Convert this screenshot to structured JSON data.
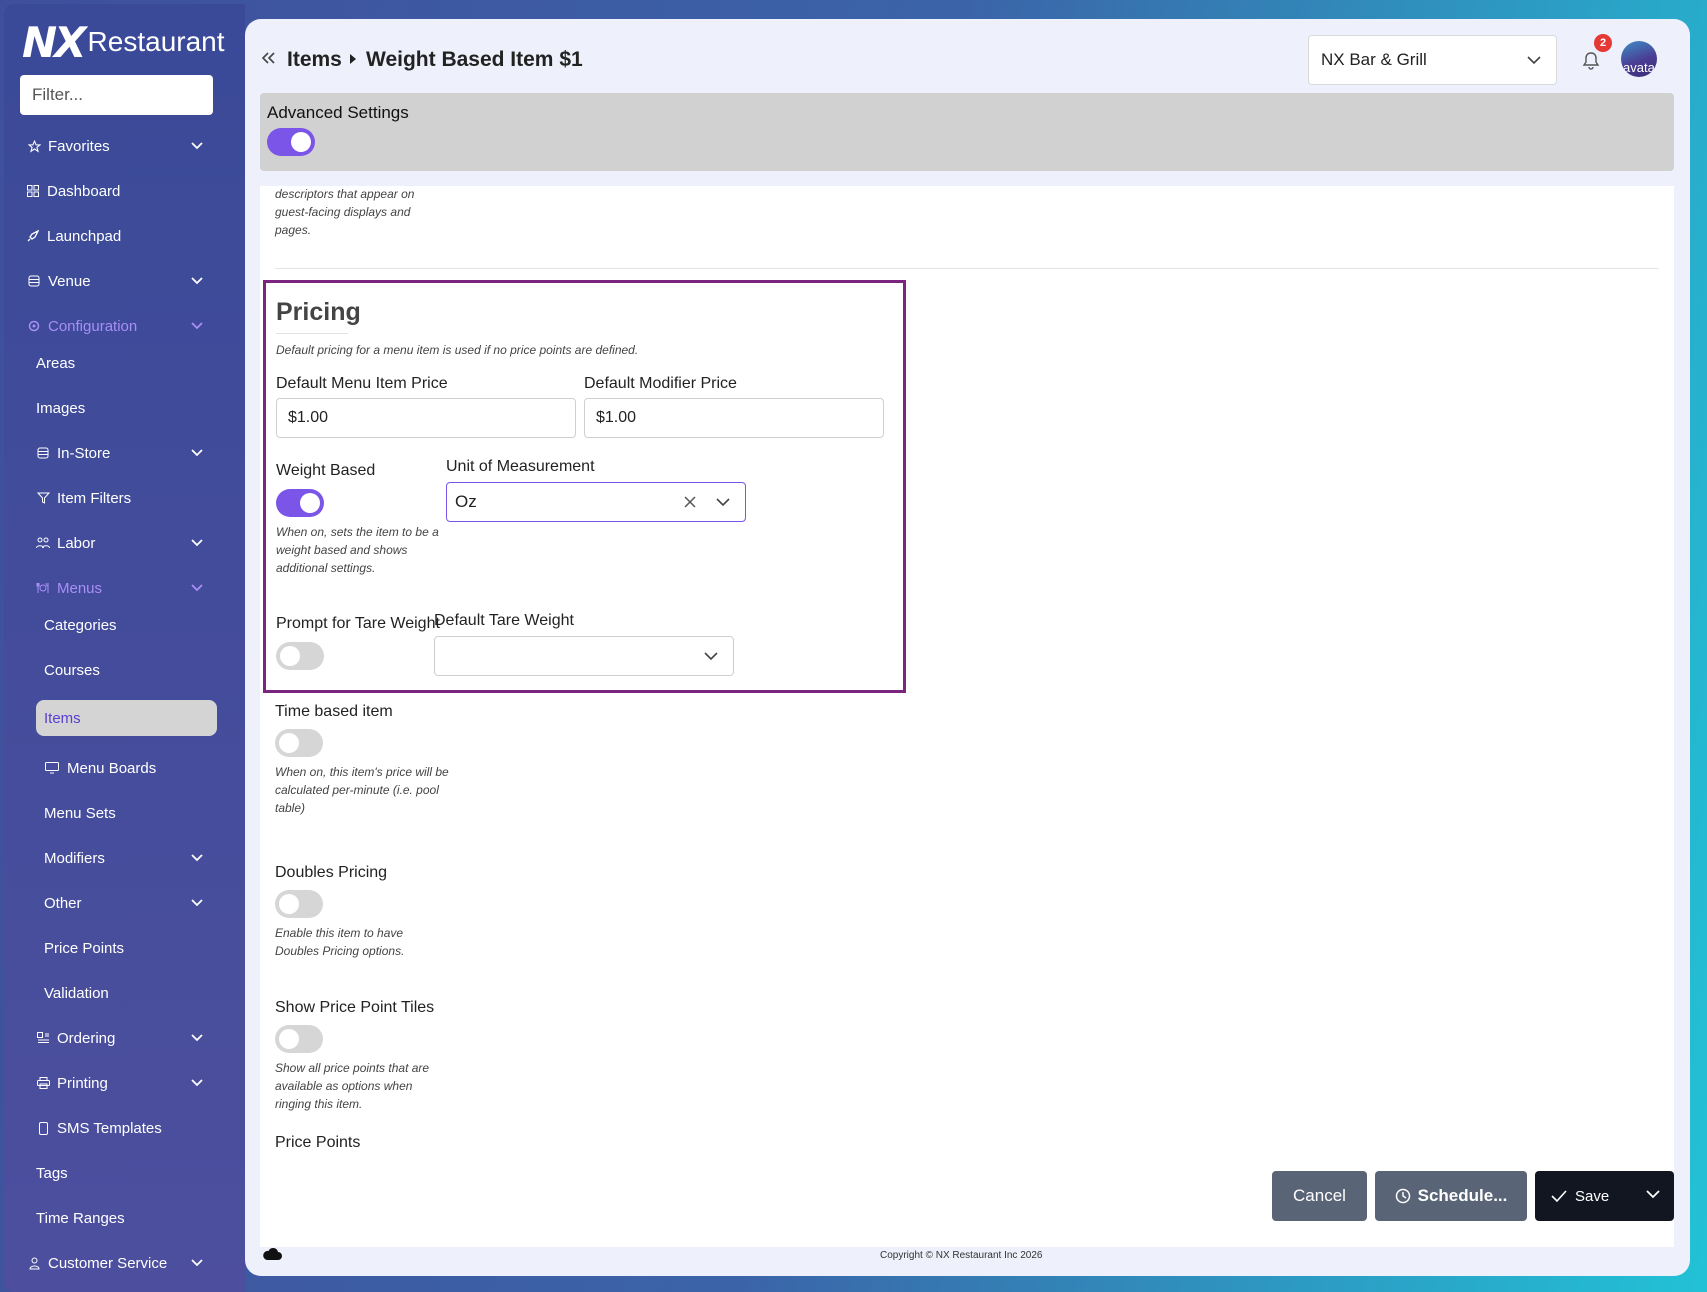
{
  "sidebar": {
    "brand_mark": "NX",
    "brand_name": "Restaurant",
    "filter_placeholder": "Filter...",
    "items": [
      {
        "label": "Favorites",
        "icon": "star-icon"
      },
      {
        "label": "Dashboard",
        "icon": "dashboard-icon"
      },
      {
        "label": "Launchpad",
        "icon": "rocket-icon"
      },
      {
        "label": "Venue",
        "icon": "database-icon"
      },
      {
        "label": "Configuration",
        "icon": "gear-icon"
      },
      {
        "label": "Areas"
      },
      {
        "label": "Images"
      },
      {
        "label": "In-Store",
        "icon": "database-icon"
      },
      {
        "label": "Item Filters",
        "icon": "filter-icon"
      },
      {
        "label": "Labor",
        "icon": "people-icon"
      },
      {
        "label": "Menus",
        "icon": "utensils-icon"
      },
      {
        "label": "Categories"
      },
      {
        "label": "Courses"
      },
      {
        "label": "Items"
      },
      {
        "label": "Menu Boards",
        "icon": "monitor-icon"
      },
      {
        "label": "Menu Sets"
      },
      {
        "label": "Modifiers"
      },
      {
        "label": "Other"
      },
      {
        "label": "Price Points"
      },
      {
        "label": "Validation"
      },
      {
        "label": "Ordering",
        "icon": "ordering-icon"
      },
      {
        "label": "Printing",
        "icon": "printer-icon"
      },
      {
        "label": "SMS Templates",
        "icon": "phone-icon"
      },
      {
        "label": "Tags"
      },
      {
        "label": "Time Ranges"
      },
      {
        "label": "Customer Service",
        "icon": "person-icon"
      }
    ]
  },
  "header": {
    "breadcrumb_parent": "Items",
    "breadcrumb_current": "Weight Based Item $1",
    "venue": "NX Bar & Grill",
    "notification_count": "2",
    "avatar_alt": "avatar"
  },
  "advanced": {
    "label": "Advanced Settings",
    "enabled": true
  },
  "form": {
    "descriptor_hint": [
      "descriptors that appear on",
      "guest-facing displays and",
      "pages."
    ],
    "pricing": {
      "title": "Pricing",
      "hint": "Default pricing for a menu item is used if no price points are defined.",
      "default_item_price_label": "Default Menu Item Price",
      "default_item_price": "$1.00",
      "default_modifier_price_label": "Default Modifier Price",
      "default_modifier_price": "$1.00",
      "weight_based_label": "Weight Based",
      "weight_based_on": true,
      "weight_based_hint": [
        "When on, sets the item to be a",
        "weight based and shows",
        "additional settings."
      ],
      "uom_label": "Unit of Measurement",
      "uom_value": "Oz",
      "tare_prompt_label": "Prompt for Tare Weight",
      "tare_prompt_on": false,
      "default_tare_label": "Default Tare Weight",
      "default_tare_value": ""
    },
    "time_based": {
      "label": "Time based item",
      "on": false,
      "hint": [
        "When on, this item's price will be",
        "calculated per-minute (i.e. pool",
        "table)"
      ]
    },
    "doubles": {
      "label": "Doubles Pricing",
      "on": false,
      "hint": [
        "Enable this item to have",
        "Doubles Pricing options."
      ]
    },
    "price_tiles": {
      "label": "Show Price Point Tiles",
      "on": false,
      "hint": [
        "Show all price points that are",
        "available as options when",
        "ringing this item."
      ]
    },
    "price_points_label": "Price Points"
  },
  "footer": {
    "cancel": "Cancel",
    "schedule": "Schedule...",
    "save": "Save",
    "copyright": "Copyright © NX Restaurant Inc 2026"
  },
  "colors": {
    "accent": "#7b55e8",
    "pricing_border": "#7b2580",
    "sidebar": "#3f4b98"
  }
}
